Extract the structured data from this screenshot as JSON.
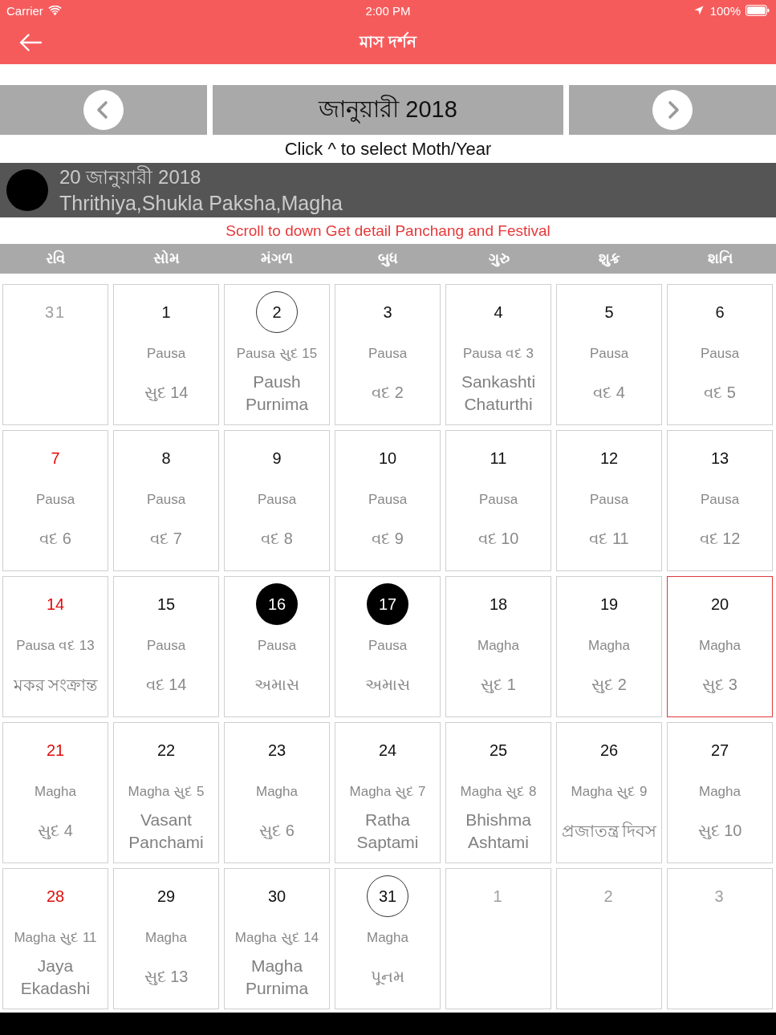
{
  "status_bar": {
    "carrier": "Carrier",
    "time": "2:00 PM",
    "battery": "100%"
  },
  "nav_bar": {
    "title": "মাস দর্শন"
  },
  "month_nav": {
    "title": "জানুয়ারী 2018",
    "hint": "Click ^ to select Moth/Year"
  },
  "selected_day": {
    "date": "20 জানুয়ারী 2018",
    "details": "Thrithiya,Shukla Paksha,Magha"
  },
  "notice": "Scroll to down Get detail Panchang and Festival",
  "weekdays": [
    "રવિ",
    "સોમ",
    "મંગળ",
    "બુધ",
    "ગુરુ",
    "શુક્ર",
    "શનિ"
  ],
  "cells": [
    {
      "day": "31",
      "kind": "other",
      "full_moon": false,
      "new_moon": false,
      "selected": false
    },
    {
      "day": "1",
      "kind": "day",
      "full_moon": false,
      "new_moon": false,
      "selected": false,
      "subtitle": "Pausa",
      "tithi": "સુદ 14"
    },
    {
      "day": "2",
      "kind": "day",
      "full_moon": true,
      "new_moon": false,
      "selected": false,
      "subtitle": "Pausa સુદ 15",
      "festival": "Paush Purnima"
    },
    {
      "day": "3",
      "kind": "day",
      "full_moon": false,
      "new_moon": false,
      "selected": false,
      "subtitle": "Pausa",
      "tithi": "વદ 2"
    },
    {
      "day": "4",
      "kind": "day",
      "full_moon": false,
      "new_moon": false,
      "selected": false,
      "subtitle": "Pausa વદ 3",
      "festival": "Sankashti Chaturthi"
    },
    {
      "day": "5",
      "kind": "day",
      "full_moon": false,
      "new_moon": false,
      "selected": false,
      "subtitle": "Pausa",
      "tithi": "વદ 4"
    },
    {
      "day": "6",
      "kind": "day",
      "full_moon": false,
      "new_moon": false,
      "selected": false,
      "subtitle": "Pausa",
      "tithi": "વદ 5"
    },
    {
      "day": "7",
      "kind": "sunday",
      "full_moon": false,
      "new_moon": false,
      "selected": false,
      "subtitle": "Pausa",
      "tithi": "વદ 6"
    },
    {
      "day": "8",
      "kind": "day",
      "full_moon": false,
      "new_moon": false,
      "selected": false,
      "subtitle": "Pausa",
      "tithi": "વદ 7"
    },
    {
      "day": "9",
      "kind": "day",
      "full_moon": false,
      "new_moon": false,
      "selected": false,
      "subtitle": "Pausa",
      "tithi": "વદ 8"
    },
    {
      "day": "10",
      "kind": "day",
      "full_moon": false,
      "new_moon": false,
      "selected": false,
      "subtitle": "Pausa",
      "tithi": "વદ 9"
    },
    {
      "day": "11",
      "kind": "day",
      "full_moon": false,
      "new_moon": false,
      "selected": false,
      "subtitle": "Pausa",
      "tithi": "વદ 10"
    },
    {
      "day": "12",
      "kind": "day",
      "full_moon": false,
      "new_moon": false,
      "selected": false,
      "subtitle": "Pausa",
      "tithi": "વદ 11"
    },
    {
      "day": "13",
      "kind": "day",
      "full_moon": false,
      "new_moon": false,
      "selected": false,
      "subtitle": "Pausa",
      "tithi": "વદ 12"
    },
    {
      "day": "14",
      "kind": "sunday",
      "full_moon": false,
      "new_moon": false,
      "selected": false,
      "subtitle": "Pausa વદ 13",
      "festival": "মকর সংক্রান্ত"
    },
    {
      "day": "15",
      "kind": "day",
      "full_moon": false,
      "new_moon": false,
      "selected": false,
      "subtitle": "Pausa",
      "tithi": "વદ 14"
    },
    {
      "day": "16",
      "kind": "day",
      "full_moon": false,
      "new_moon": true,
      "selected": false,
      "subtitle": "Pausa",
      "tithi": "અમાસ"
    },
    {
      "day": "17",
      "kind": "day",
      "full_moon": false,
      "new_moon": true,
      "selected": false,
      "subtitle": "Pausa",
      "tithi": "અમાસ"
    },
    {
      "day": "18",
      "kind": "day",
      "full_moon": false,
      "new_moon": false,
      "selected": false,
      "subtitle": "Magha",
      "tithi": "સુદ 1"
    },
    {
      "day": "19",
      "kind": "day",
      "full_moon": false,
      "new_moon": false,
      "selected": false,
      "subtitle": "Magha",
      "tithi": "સુદ 2"
    },
    {
      "day": "20",
      "kind": "day",
      "full_moon": false,
      "new_moon": false,
      "selected": true,
      "subtitle": "Magha",
      "tithi": "સુદ 3"
    },
    {
      "day": "21",
      "kind": "sunday",
      "full_moon": false,
      "new_moon": false,
      "selected": false,
      "subtitle": "Magha",
      "tithi": "સુદ 4"
    },
    {
      "day": "22",
      "kind": "day",
      "full_moon": false,
      "new_moon": false,
      "selected": false,
      "subtitle": "Magha સુદ 5",
      "festival": "Vasant Panchami"
    },
    {
      "day": "23",
      "kind": "day",
      "full_moon": false,
      "new_moon": false,
      "selected": false,
      "subtitle": "Magha",
      "tithi": "સુદ 6"
    },
    {
      "day": "24",
      "kind": "day",
      "full_moon": false,
      "new_moon": false,
      "selected": false,
      "subtitle": "Magha સુદ 7",
      "festival": "Ratha Saptami"
    },
    {
      "day": "25",
      "kind": "day",
      "full_moon": false,
      "new_moon": false,
      "selected": false,
      "subtitle": "Magha સુદ 8",
      "festival": "Bhishma Ashtami"
    },
    {
      "day": "26",
      "kind": "day",
      "full_moon": false,
      "new_moon": false,
      "selected": false,
      "subtitle": "Magha સુદ 9",
      "festival": "প্রজাতন্ত্র দিবস"
    },
    {
      "day": "27",
      "kind": "day",
      "full_moon": false,
      "new_moon": false,
      "selected": false,
      "subtitle": "Magha",
      "tithi": "સુદ 10"
    },
    {
      "day": "28",
      "kind": "sunday",
      "full_moon": false,
      "new_moon": false,
      "selected": false,
      "subtitle": "Magha સુદ 11",
      "festival": "Jaya Ekadashi"
    },
    {
      "day": "29",
      "kind": "day",
      "full_moon": false,
      "new_moon": false,
      "selected": false,
      "subtitle": "Magha",
      "tithi": "સુદ 13"
    },
    {
      "day": "30",
      "kind": "day",
      "full_moon": false,
      "new_moon": false,
      "selected": false,
      "subtitle": "Magha સુદ 14",
      "festival": "Magha Purnima"
    },
    {
      "day": "31",
      "kind": "day",
      "full_moon": true,
      "new_moon": false,
      "selected": false,
      "subtitle": "Magha",
      "tithi": "પૂનમ"
    },
    {
      "day": "1",
      "kind": "other",
      "full_moon": false,
      "new_moon": false,
      "selected": false
    },
    {
      "day": "2",
      "kind": "other",
      "full_moon": false,
      "new_moon": false,
      "selected": false
    },
    {
      "day": "3",
      "kind": "other",
      "full_moon": false,
      "new_moon": false,
      "selected": false
    }
  ]
}
